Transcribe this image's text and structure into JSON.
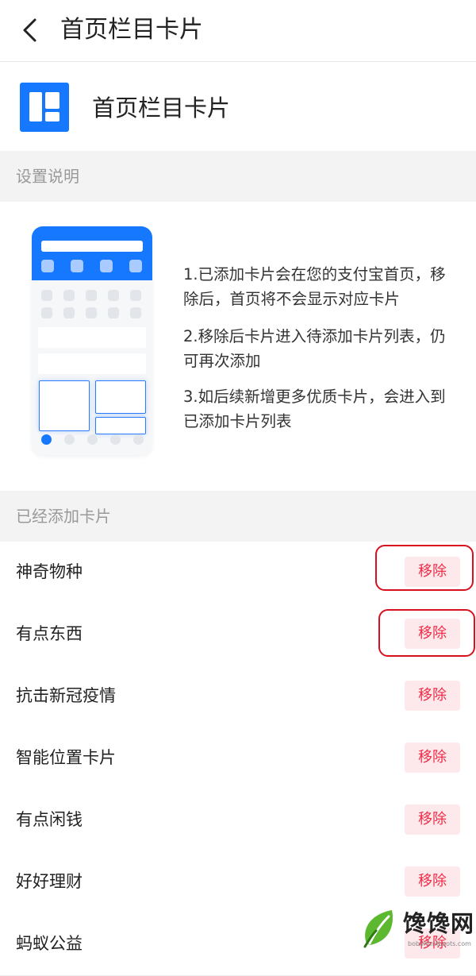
{
  "nav": {
    "title": "首页栏目卡片",
    "back_icon": "chevron-left-icon"
  },
  "card": {
    "icon": "layout-cards-icon",
    "icon_color": "#1677ff",
    "title": "首页栏目卡片"
  },
  "settings_section": {
    "label": "设置说明"
  },
  "instructions": {
    "illustration": "phone-home-layout",
    "steps": [
      "1.已添加卡片会在您的支付宝首页，移除后，首页将不会显示对应卡片",
      "2.移除后卡片进入待添加卡片列表，仍可再次添加",
      "3.如后续新增更多优质卡片，会进入到已添加卡片列表"
    ]
  },
  "added_section": {
    "label": "已经添加卡片"
  },
  "cards": [
    {
      "name": "神奇物种",
      "action": "移除",
      "highlighted": true
    },
    {
      "name": "有点东西",
      "action": "移除",
      "highlighted": true
    },
    {
      "name": "抗击新冠疫情",
      "action": "移除",
      "highlighted": false
    },
    {
      "name": "智能位置卡片",
      "action": "移除",
      "highlighted": false
    },
    {
      "name": "有点闲钱",
      "action": "移除",
      "highlighted": false
    },
    {
      "name": "好好理财",
      "action": "移除",
      "highlighted": false
    },
    {
      "name": "蚂蚁公益",
      "action": "移除",
      "highlighted": false
    }
  ],
  "colors": {
    "accent": "#1677ff",
    "remove_text": "#ee2c46",
    "remove_bg": "#fde9ec",
    "annotation": "#d8101e"
  },
  "watermark": {
    "text": "馋馋网",
    "subtext": "bobohtmlboots.com",
    "logo": "leaf-logo"
  }
}
